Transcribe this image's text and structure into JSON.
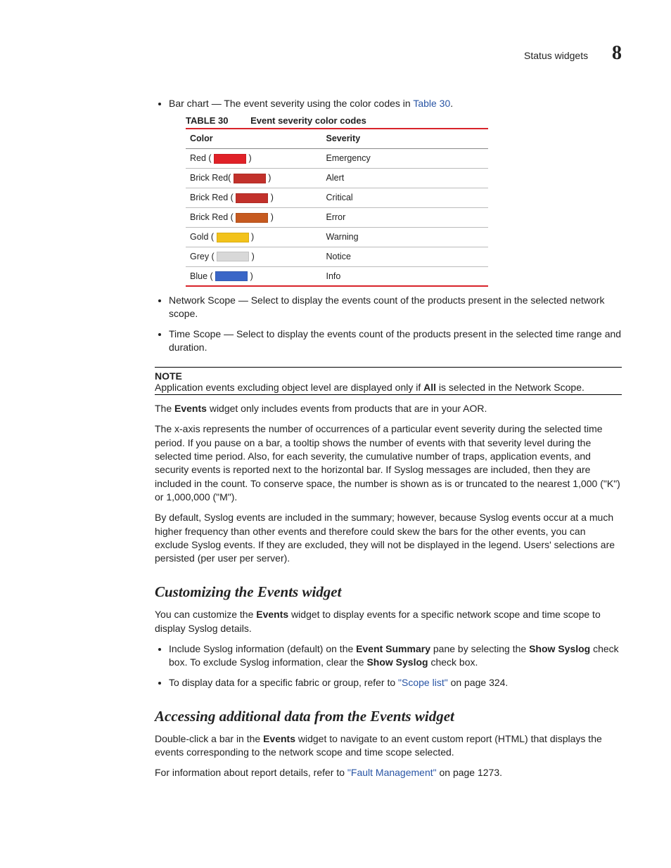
{
  "header": {
    "section": "Status widgets",
    "chapnum": "8"
  },
  "bullet_barchart": {
    "prefix": "Bar chart — The event severity using the color codes in ",
    "link": "Table 30",
    "suffix": "."
  },
  "table30": {
    "label": "TABLE 30",
    "title": "Event severity color codes",
    "head_color": "Color",
    "head_sev": "Severity",
    "rows": [
      {
        "name_pre": "Red ( ",
        "name_post": " )",
        "hex": "#e02127",
        "sev": "Emergency"
      },
      {
        "name_pre": "Brick Red( ",
        "name_post": " )",
        "hex": "#c2312b",
        "sev": "Alert"
      },
      {
        "name_pre": "Brick Red ( ",
        "name_post": " )",
        "hex": "#c2312b",
        "sev": "Critical"
      },
      {
        "name_pre": "Brick Red ( ",
        "name_post": " )",
        "hex": "#c65a20",
        "sev": "Error"
      },
      {
        "name_pre": "Gold ( ",
        "name_post": " )",
        "hex": "#f2c21a",
        "sev": "Warning"
      },
      {
        "name_pre": "Grey ( ",
        "name_post": " )",
        "hex": "#d8d8d8",
        "sev": "Notice"
      },
      {
        "name_pre": "Blue ( ",
        "name_post": " )",
        "hex": "#3a66c7",
        "sev": "Info"
      }
    ]
  },
  "bullet_netscope": "Network Scope — Select to display the events count of the products present in the selected network scope.",
  "bullet_timescope": "Time Scope — Select to display the events count of the products present in the selected time range and duration.",
  "note": {
    "title": "NOTE",
    "body_pre": "Application events excluding object level are displayed only if ",
    "body_bold": "All",
    "body_post": " is selected in the Network Scope."
  },
  "para_events_widget": {
    "pre": "The ",
    "bold": "Events",
    "post": " widget only includes events from products that are in your AOR."
  },
  "para_xaxis": "The x-axis represents the number of occurrences of a particular event severity during the selected time period. If you pause on a bar, a tooltip shows the number of events with that severity level during the selected time period. Also, for each severity, the cumulative number of traps, application events, and security events is reported next to the horizontal bar. If Syslog messages are included, then they are included in the count. To conserve space, the number is shown as is or truncated to the nearest 1,000 (\"K\") or 1,000,000 (\"M\").",
  "para_syslog_default": "By default, Syslog events are included in the summary; however, because Syslog events occur at a much higher frequency than other events and therefore could skew the bars for the other events, you can exclude Syslog events.   If they are excluded, they will not be displayed in the legend. Users' selections are persisted (per user per server).",
  "h_customizing": "Customizing the Events widget",
  "para_customize": {
    "pre": "You can customize the ",
    "bold": "Events",
    "post": " widget to display events for a specific network scope and time scope to display Syslog details."
  },
  "bullet_include_syslog": {
    "seg1": "Include Syslog information (default) on the ",
    "b1": "Event Summary",
    "seg2": " pane by selecting the ",
    "b2": "Show Syslog",
    "seg3": " check box. To exclude Syslog information, clear the ",
    "b3": "Show Syslog",
    "seg4": " check box."
  },
  "bullet_scope_list": {
    "pre": "To display data for a specific fabric or group, refer to ",
    "link": "\"Scope list\"",
    "post": " on page 324."
  },
  "h_accessing": "Accessing additional data from the Events widget",
  "para_dblclick": {
    "pre": "Double-click a bar in the ",
    "bold": "Events",
    "post": " widget to navigate to an event custom report (HTML) that displays the events corresponding to the network scope and time scope selected."
  },
  "para_fault": {
    "pre": "For information about report details, refer to ",
    "link": "\"Fault Management\"",
    "post": " on page 1273."
  }
}
